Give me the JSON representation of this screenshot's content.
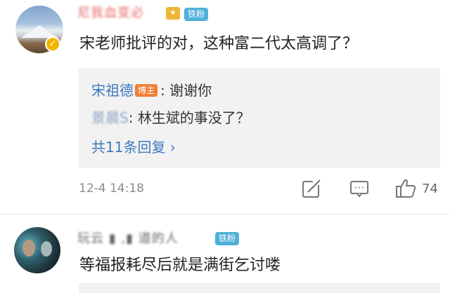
{
  "comments": [
    {
      "username": "尼我血变必",
      "badge": "铁粉",
      "content": "宋老师批评的对，这种富二代太高调了？",
      "replies": [
        {
          "name": "宋祖德",
          "tag": "博主",
          "text": "谢谢你"
        },
        {
          "name": "景晨S",
          "text": "林生斌的事没了？"
        }
      ],
      "more_replies": "共11条回复 ›",
      "time": "12-4 14:18",
      "likes": "74"
    },
    {
      "username": "玩云 ▮ ,▮ 道的人",
      "badge": "铁粉",
      "content": "等福报耗尽后就是满街乞讨喽"
    }
  ],
  "icons": {
    "share": "share-icon",
    "comment": "comment-icon",
    "like": "thumbs-up-icon",
    "verified": "verified-icon"
  },
  "colors": {
    "link_blue": "#3c79bb",
    "host_badge": "#f07f35",
    "fan_badge": "#4fb0d9"
  }
}
